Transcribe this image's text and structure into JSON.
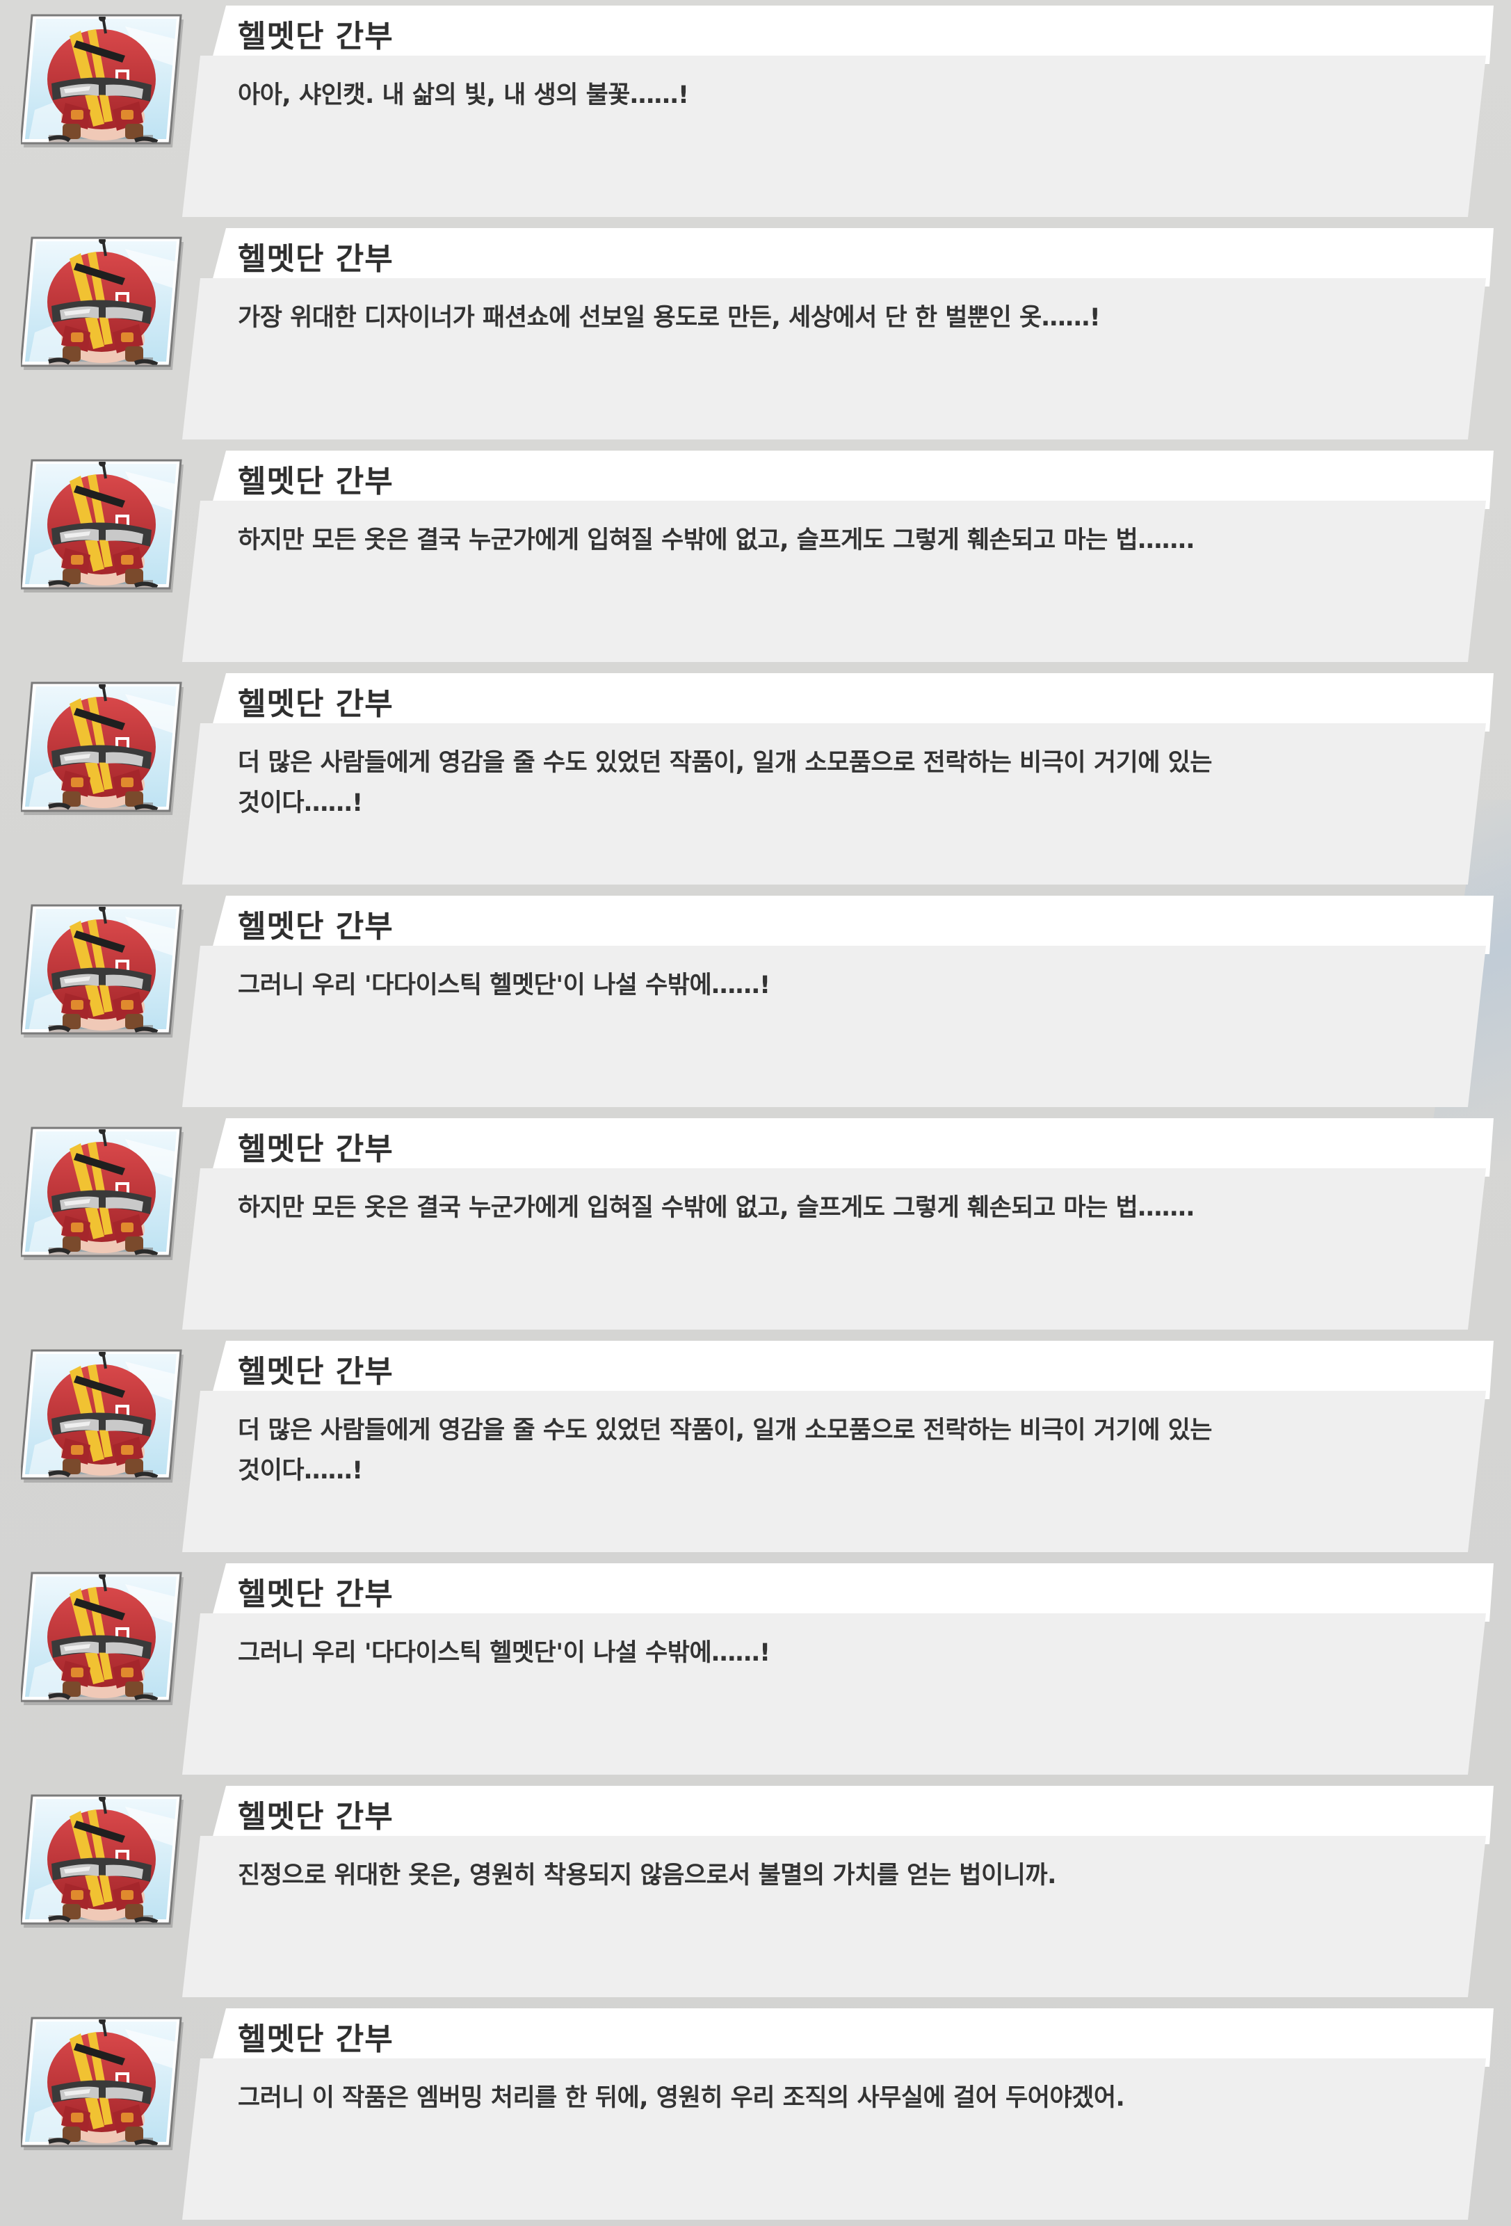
{
  "speaker": "헬멧단 간부",
  "avatar_icon": "red-helmet-character-icon",
  "colors": {
    "background": "#d6d6d4",
    "name_tab": "#ffffff",
    "bubble": "#efefef",
    "text": "#333333",
    "helmet_red": "#c8373a",
    "helmet_stripe": "#f1c232",
    "frame_sky": "#d9eef8"
  },
  "dialogue": [
    {
      "speaker": "헬멧단 간부",
      "text": "아아, 샤인캣. 내 삶의 빛, 내 생의 불꽃……!"
    },
    {
      "speaker": "헬멧단 간부",
      "text": "가장 위대한 디자이너가 패션쇼에 선보일 용도로 만든, 세상에서 단 한 벌뿐인 옷……!"
    },
    {
      "speaker": "헬멧단 간부",
      "text": "하지만 모든 옷은 결국 누군가에게 입혀질 수밖에 없고, 슬프게도 그렇게 훼손되고 마는 법……."
    },
    {
      "speaker": "헬멧단 간부",
      "text": "더 많은 사람들에게 영감을 줄 수도 있었던 작품이, 일개 소모품으로 전락하는 비극이 거기에 있는 것이다……!"
    },
    {
      "speaker": "헬멧단 간부",
      "text": "그러니 우리 '다다이스틱 헬멧단'이 나설 수밖에……!"
    },
    {
      "speaker": "헬멧단 간부",
      "text": "하지만 모든 옷은 결국 누군가에게 입혀질 수밖에 없고, 슬프게도 그렇게 훼손되고 마는 법……."
    },
    {
      "speaker": "헬멧단 간부",
      "text": "더 많은 사람들에게 영감을 줄 수도 있었던 작품이, 일개 소모품으로 전락하는 비극이 거기에 있는 것이다……!"
    },
    {
      "speaker": "헬멧단 간부",
      "text": "그러니 우리 '다다이스틱 헬멧단'이 나설 수밖에……!"
    },
    {
      "speaker": "헬멧단 간부",
      "text": "진정으로 위대한 옷은, 영원히 착용되지 않음으로서 불멸의 가치를 얻는 법이니까."
    },
    {
      "speaker": "헬멧단 간부",
      "text": "그러니 이 작품은 엠버밍 처리를 한 뒤에, 영원히 우리 조직의 사무실에 걸어 두어야겠어."
    }
  ]
}
